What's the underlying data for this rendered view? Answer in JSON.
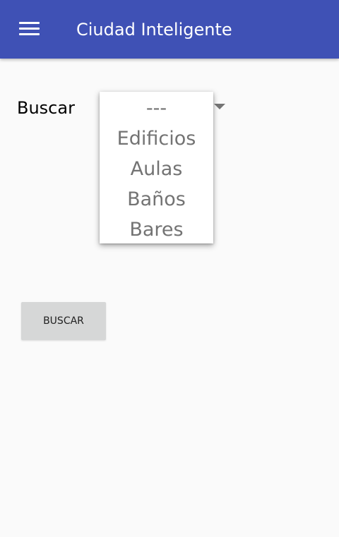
{
  "app_bar": {
    "title": "Ciudad Inteligente",
    "menu_icon": "hamburger-menu-icon",
    "color": "#3f51b5"
  },
  "form": {
    "search_label": "Buscar",
    "dropdown": {
      "arrow_icon": "dropdown-arrow-icon",
      "options": [
        {
          "label": "---"
        },
        {
          "label": "Edificios"
        },
        {
          "label": "Aulas"
        },
        {
          "label": "Baños"
        },
        {
          "label": "Bares"
        }
      ]
    },
    "submit_button": {
      "label": "BUSCAR",
      "color": "#d6d7d7"
    }
  }
}
